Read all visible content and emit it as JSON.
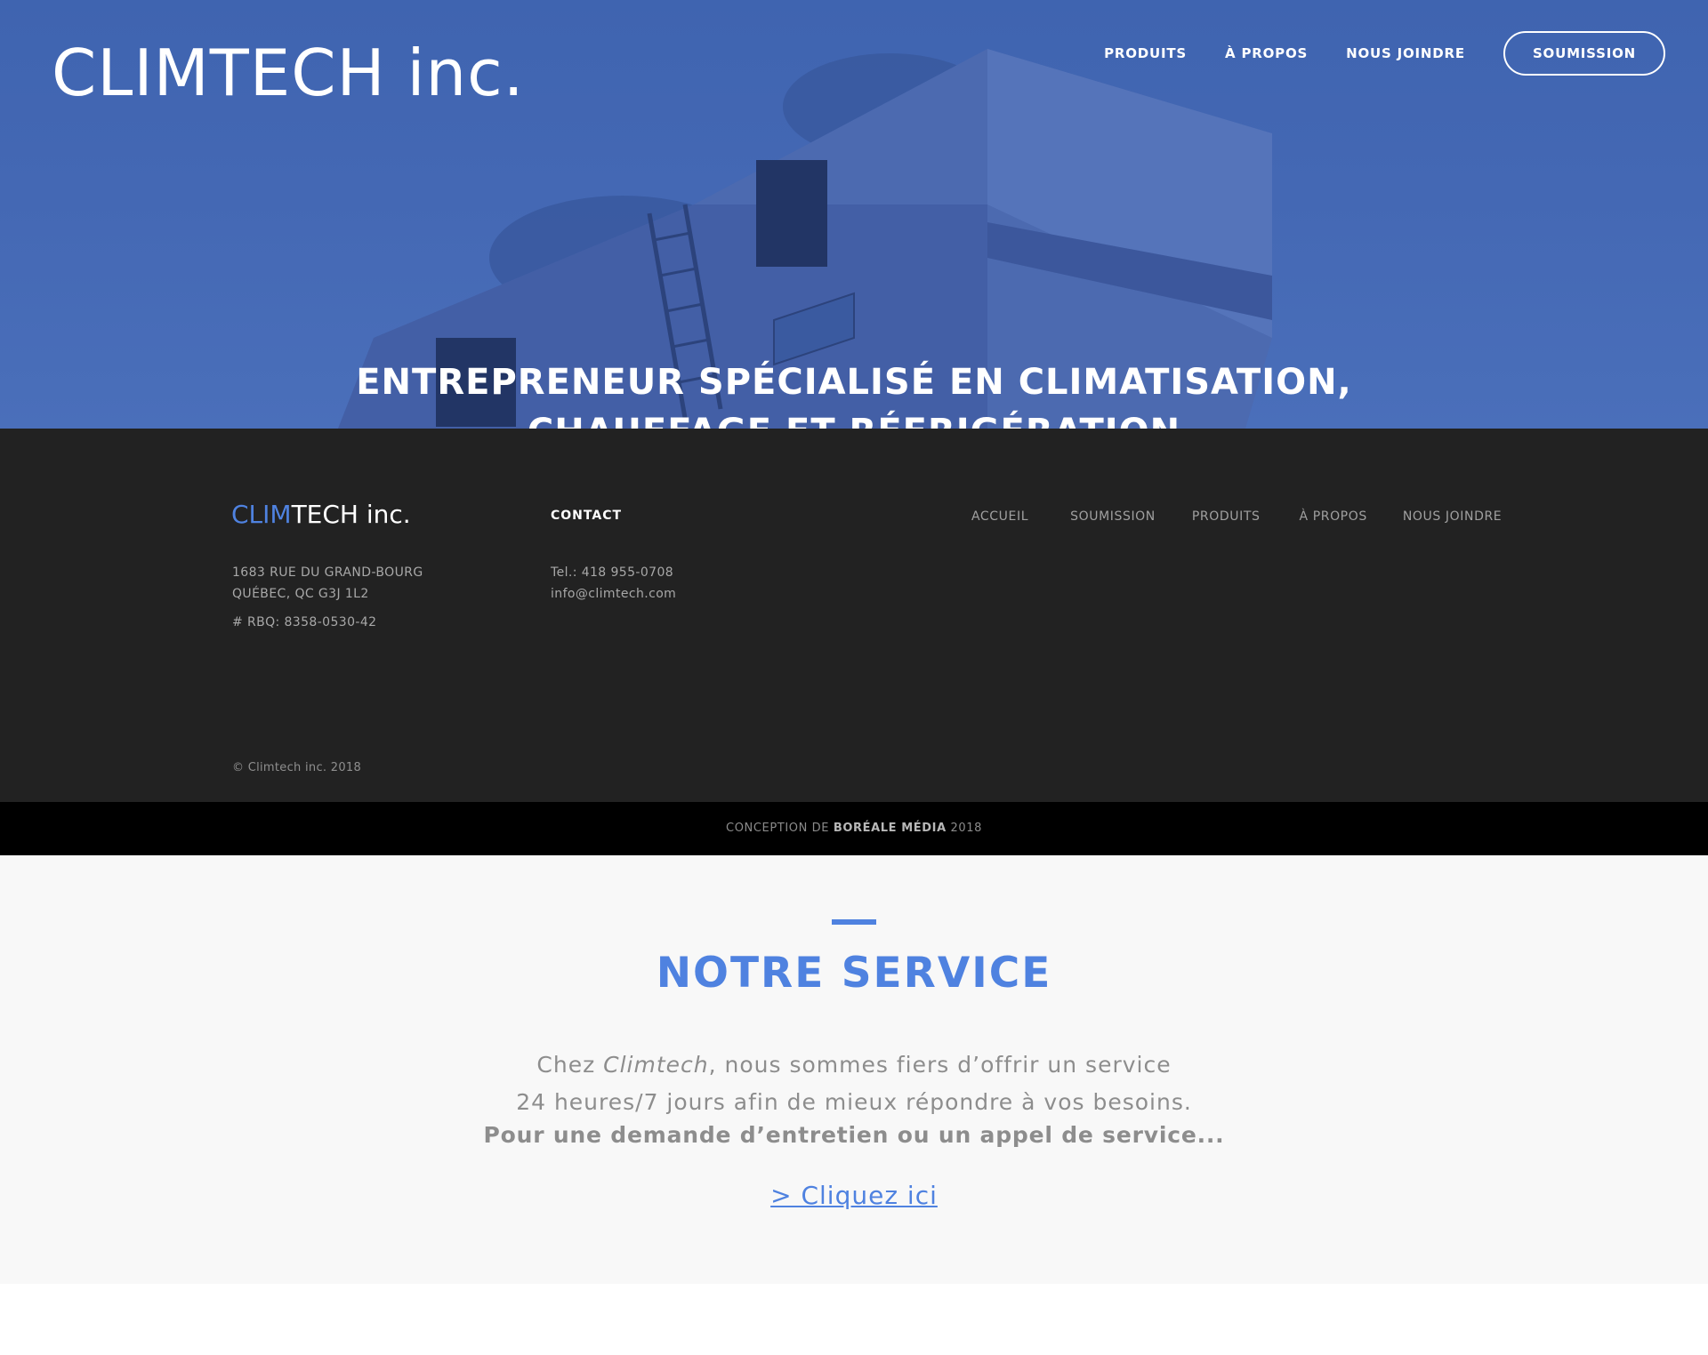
{
  "header": {
    "brand": "CLIMTECH inc.",
    "nav": [
      "PRODUITS",
      "À PROPOS",
      "NOUS JOINDRE"
    ],
    "cta": "SOUMISSION",
    "hero_title_line1": "ENTREPRENEUR SPÉCIALISÉ EN CLIMATISATION,",
    "hero_title_line2": "CHAUFFAGE ET RÉFRIGÉRATION"
  },
  "footer": {
    "brand_accent": "CLIM",
    "brand_rest": "TECH inc.",
    "address_line1": "1683 RUE DU GRAND-BOURG",
    "address_line2": "QUÉBEC, QC  G3J 1L2",
    "rbq": "# RBQ: 8358-0530-42",
    "contact_heading": "CONTACT",
    "phone": "Tel.: 418 955-0708",
    "email": "info@climtech.com",
    "nav": [
      "ACCUEIL",
      "SOUMISSION",
      "PRODUITS",
      "À PROPOS",
      "NOUS JOINDRE"
    ],
    "copyright": "© Climtech inc. 2018",
    "credit_prefix": "CONCEPTION DE ",
    "credit_name": "BORÉALE MÉDIA",
    "credit_suffix": " 2018"
  },
  "service": {
    "title": "NOTRE SERVICE",
    "line1_pre": "Chez ",
    "line1_em": "Climtech",
    "line1_post": ", nous sommes fiers d’offrir un service",
    "line2": "24 heures/7 jours afin de mieux répondre à vos besoins.",
    "line3": "Pour une demande d’entretien ou un appel de service...",
    "link": "> Cliquez ici"
  },
  "colors": {
    "accent": "#4f82e0",
    "hero_blue": "#4468b4",
    "footer_bg": "#222222",
    "credit_bg": "#000000",
    "section_bg": "#f8f8f8"
  }
}
